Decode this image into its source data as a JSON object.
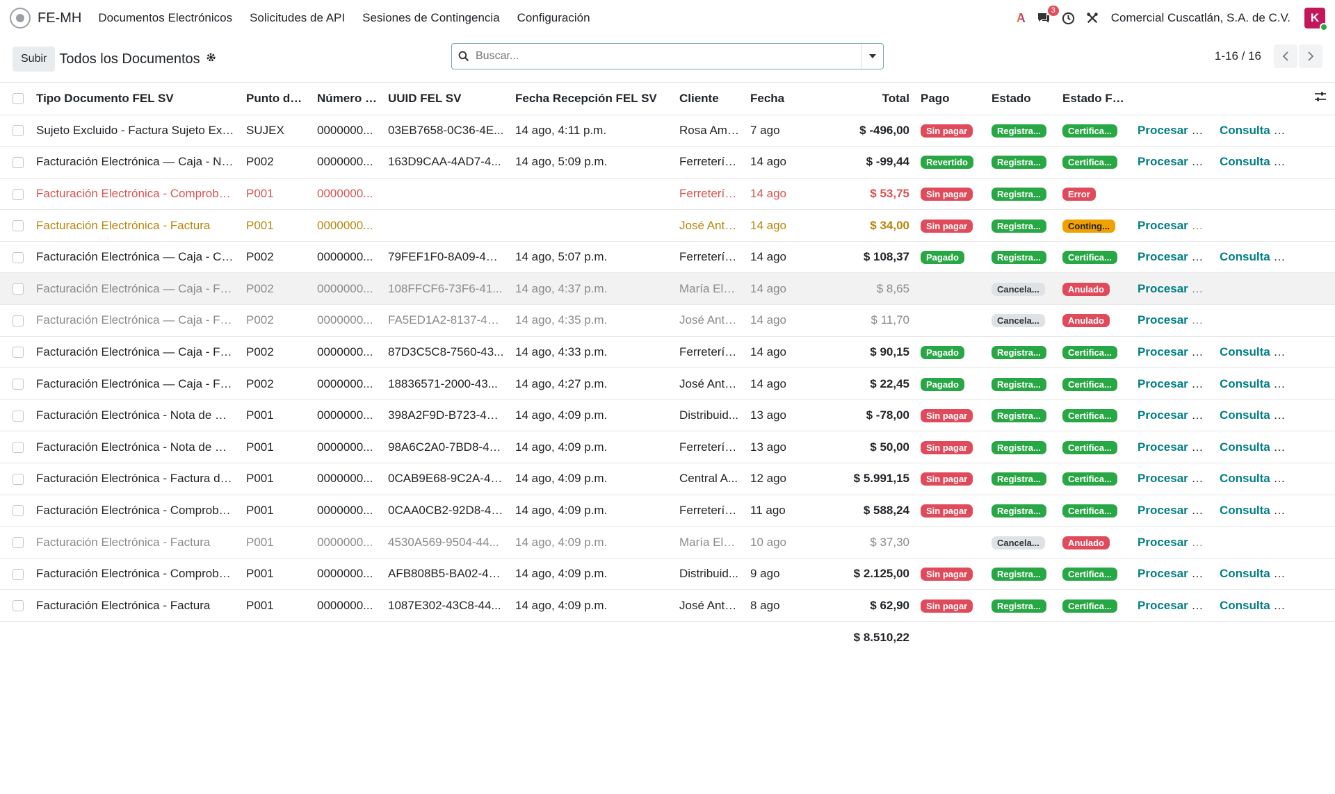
{
  "nav": {
    "brand": "FE-MH",
    "menu": [
      "Documentos Electrónicos",
      "Solicitudes de API",
      "Sesiones de Contingencia",
      "Configuración"
    ],
    "messages_count": "3",
    "company": "Comercial Cuscatlán, S.A. de C.V.",
    "avatar_letter": "K"
  },
  "control": {
    "upload_label": "Subir",
    "title": "Todos los Documentos",
    "search_placeholder": "Buscar...",
    "pager_value": "1-16 / 16"
  },
  "table": {
    "columns": [
      "Tipo Documento FEL SV",
      "Punto de ...",
      "Número D...",
      "UUID FEL SV",
      "Fecha Recepción FEL SV",
      "Cliente",
      "Fecha",
      "Total",
      "Pago",
      "Estado",
      "Estado FE..."
    ],
    "rows": [
      {
        "style": "normal",
        "tipo": "Sujeto Excluido - Factura Sujeto Excl...",
        "punto": "SUJEX",
        "numero": "0000000...",
        "uuid": "03EB7658-0C36-4E...",
        "recepcion": "14 ago, 4:11 p.m.",
        "cliente": "Rosa Amel...",
        "fecha": "7 ago",
        "total": "$ -496,00",
        "pago": "Sin pagar",
        "pago_color": "red",
        "estado": "Registra...",
        "estado_color": "green",
        "estado_fel": "Certifica...",
        "estado_fel_color": "green",
        "procesar": "Procesar FEL",
        "consulta": "Consulta DTE"
      },
      {
        "style": "normal",
        "tipo": "Facturación Electrónica — Caja - Not...",
        "punto": "P002",
        "numero": "0000000...",
        "uuid": "163D9CAA-4AD7-4...",
        "recepcion": "14 ago, 5:09 p.m.",
        "cliente": "Ferretería ...",
        "fecha": "14 ago",
        "total": "$ -99,44",
        "pago": "Revertido",
        "pago_color": "green",
        "estado": "Registra...",
        "estado_color": "green",
        "estado_fel": "Certifica...",
        "estado_fel_color": "green",
        "procesar": "Procesar FEL",
        "consulta": "Consulta DTE"
      },
      {
        "style": "danger",
        "tipo": "Facturación Electrónica - Comproban...",
        "punto": "P001",
        "numero": "0000000...",
        "uuid": "",
        "recepcion": "",
        "cliente": "Ferretería ...",
        "fecha": "14 ago",
        "total": "$ 53,75",
        "pago": "Sin pagar",
        "pago_color": "red",
        "estado": "Registra...",
        "estado_color": "green",
        "estado_fel": "Error",
        "estado_fel_color": "red",
        "procesar": "",
        "consulta": ""
      },
      {
        "style": "warning",
        "tipo": "Facturación Electrónica - Factura",
        "punto": "P001",
        "numero": "0000000...",
        "uuid": "",
        "recepcion": "",
        "cliente": "José Anto...",
        "fecha": "14 ago",
        "total": "$ 34,00",
        "pago": "Sin pagar",
        "pago_color": "red",
        "estado": "Registra...",
        "estado_color": "green",
        "estado_fel": "Conting...",
        "estado_fel_color": "orange",
        "procesar": "Procesar FEL",
        "consulta": ""
      },
      {
        "style": "normal",
        "tipo": "Facturación Electrónica — Caja - Com...",
        "punto": "P002",
        "numero": "0000000...",
        "uuid": "79FEF1F0-8A09-4C...",
        "recepcion": "14 ago, 5:07 p.m.",
        "cliente": "Ferretería ...",
        "fecha": "14 ago",
        "total": "$ 108,37",
        "pago": "Pagado",
        "pago_color": "green",
        "estado": "Registra...",
        "estado_color": "green",
        "estado_fel": "Certifica...",
        "estado_fel_color": "green",
        "procesar": "Procesar FEL",
        "consulta": "Consulta DTE"
      },
      {
        "style": "muted hover",
        "tipo": "Facturación Electrónica — Caja - Fact...",
        "punto": "P002",
        "numero": "0000000...",
        "uuid": "108FFCF6-73F6-41...",
        "recepcion": "14 ago, 4:37 p.m.",
        "cliente": "María Elen...",
        "fecha": "14 ago",
        "total": "$ 8,65",
        "pago": "",
        "pago_color": "",
        "estado": "Cancela...",
        "estado_color": "gray",
        "estado_fel": "Anulado",
        "estado_fel_color": "red",
        "procesar": "Procesar FEL",
        "consulta": ""
      },
      {
        "style": "muted",
        "tipo": "Facturación Electrónica — Caja - Fact...",
        "punto": "P002",
        "numero": "0000000...",
        "uuid": "FA5ED1A2-8137-4B...",
        "recepcion": "14 ago, 4:35 p.m.",
        "cliente": "José Anto...",
        "fecha": "14 ago",
        "total": "$ 11,70",
        "pago": "",
        "pago_color": "",
        "estado": "Cancela...",
        "estado_color": "gray",
        "estado_fel": "Anulado",
        "estado_fel_color": "red",
        "procesar": "Procesar FEL",
        "consulta": ""
      },
      {
        "style": "normal",
        "tipo": "Facturación Electrónica — Caja - Fact...",
        "punto": "P002",
        "numero": "0000000...",
        "uuid": "87D3C5C8-7560-43...",
        "recepcion": "14 ago, 4:33 p.m.",
        "cliente": "Ferretería ...",
        "fecha": "14 ago",
        "total": "$ 90,15",
        "pago": "Pagado",
        "pago_color": "green",
        "estado": "Registra...",
        "estado_color": "green",
        "estado_fel": "Certifica...",
        "estado_fel_color": "green",
        "procesar": "Procesar FEL",
        "consulta": "Consulta DTE"
      },
      {
        "style": "normal",
        "tipo": "Facturación Electrónica — Caja - Fact...",
        "punto": "P002",
        "numero": "0000000...",
        "uuid": "18836571-2000-43...",
        "recepcion": "14 ago, 4:27 p.m.",
        "cliente": "José Anto...",
        "fecha": "14 ago",
        "total": "$ 22,45",
        "pago": "Pagado",
        "pago_color": "green",
        "estado": "Registra...",
        "estado_color": "green",
        "estado_fel": "Certifica...",
        "estado_fel_color": "green",
        "procesar": "Procesar FEL",
        "consulta": "Consulta DTE"
      },
      {
        "style": "normal",
        "tipo": "Facturación Electrónica - Nota de Cré...",
        "punto": "P001",
        "numero": "0000000...",
        "uuid": "398A2F9D-B723-4D...",
        "recepcion": "14 ago, 4:09 p.m.",
        "cliente": "Distribuid...",
        "fecha": "13 ago",
        "total": "$ -78,00",
        "pago": "Sin pagar",
        "pago_color": "red",
        "estado": "Registra...",
        "estado_color": "green",
        "estado_fel": "Certifica...",
        "estado_fel_color": "green",
        "procesar": "Procesar FEL",
        "consulta": "Consulta DTE"
      },
      {
        "style": "normal",
        "tipo": "Facturación Electrónica - Nota de Dé...",
        "punto": "P001",
        "numero": "0000000...",
        "uuid": "98A6C2A0-7BD8-4F...",
        "recepcion": "14 ago, 4:09 p.m.",
        "cliente": "Ferretería ...",
        "fecha": "13 ago",
        "total": "$ 50,00",
        "pago": "Sin pagar",
        "pago_color": "red",
        "estado": "Registra...",
        "estado_color": "green",
        "estado_fel": "Certifica...",
        "estado_fel_color": "green",
        "procesar": "Procesar FEL",
        "consulta": "Consulta DTE"
      },
      {
        "style": "normal",
        "tipo": "Facturación Electrónica - Factura de ...",
        "punto": "P001",
        "numero": "0000000...",
        "uuid": "0CAB9E68-9C2A-4A...",
        "recepcion": "14 ago, 4:09 p.m.",
        "cliente": "Central A...",
        "fecha": "12 ago",
        "total": "$ 5.991,15",
        "pago": "Sin pagar",
        "pago_color": "red",
        "estado": "Registra...",
        "estado_color": "green",
        "estado_fel": "Certifica...",
        "estado_fel_color": "green",
        "procesar": "Procesar FEL",
        "consulta": "Consulta DTE"
      },
      {
        "style": "normal",
        "tipo": "Facturación Electrónica - Comproban...",
        "punto": "P001",
        "numero": "0000000...",
        "uuid": "0CAA0CB2-92D8-4E...",
        "recepcion": "14 ago, 4:09 p.m.",
        "cliente": "Ferretería ...",
        "fecha": "11 ago",
        "total": "$ 588,24",
        "pago": "Sin pagar",
        "pago_color": "red",
        "estado": "Registra...",
        "estado_color": "green",
        "estado_fel": "Certifica...",
        "estado_fel_color": "green",
        "procesar": "Procesar FEL",
        "consulta": "Consulta DTE"
      },
      {
        "style": "muted",
        "tipo": "Facturación Electrónica - Factura",
        "punto": "P001",
        "numero": "0000000...",
        "uuid": "4530A569-9504-44...",
        "recepcion": "14 ago, 4:09 p.m.",
        "cliente": "María Elen...",
        "fecha": "10 ago",
        "total": "$ 37,30",
        "pago": "",
        "pago_color": "",
        "estado": "Cancela...",
        "estado_color": "gray",
        "estado_fel": "Anulado",
        "estado_fel_color": "red",
        "procesar": "Procesar FEL",
        "consulta": ""
      },
      {
        "style": "normal",
        "tipo": "Facturación Electrónica - Comproban...",
        "punto": "P001",
        "numero": "0000000...",
        "uuid": "AFB808B5-BA02-4E...",
        "recepcion": "14 ago, 4:09 p.m.",
        "cliente": "Distribuid...",
        "fecha": "9 ago",
        "total": "$ 2.125,00",
        "pago": "Sin pagar",
        "pago_color": "red",
        "estado": "Registra...",
        "estado_color": "green",
        "estado_fel": "Certifica...",
        "estado_fel_color": "green",
        "procesar": "Procesar FEL",
        "consulta": "Consulta DTE"
      },
      {
        "style": "normal",
        "tipo": "Facturación Electrónica - Factura",
        "punto": "P001",
        "numero": "0000000...",
        "uuid": "1087E302-43C8-44...",
        "recepcion": "14 ago, 4:09 p.m.",
        "cliente": "José Anto...",
        "fecha": "8 ago",
        "total": "$ 62,90",
        "pago": "Sin pagar",
        "pago_color": "red",
        "estado": "Registra...",
        "estado_color": "green",
        "estado_fel": "Certifica...",
        "estado_fel_color": "green",
        "procesar": "Procesar FEL",
        "consulta": "Consulta DTE"
      }
    ],
    "footer_total": "$ 8.510,22"
  }
}
